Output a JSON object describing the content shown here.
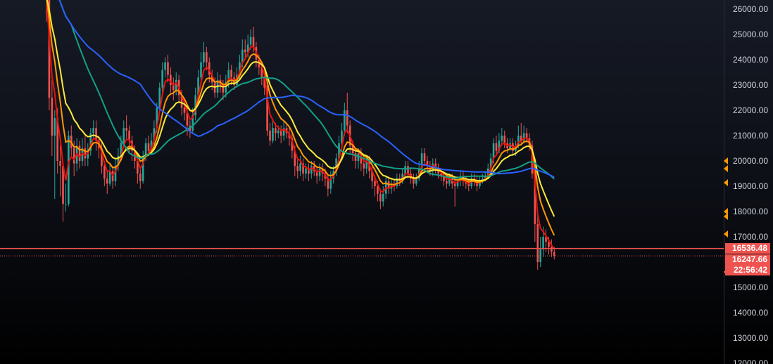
{
  "chart_data": {
    "type": "candlestick",
    "title": "",
    "xlabel": "",
    "ylabel": "",
    "ylim": [
      12000,
      26400
    ],
    "y_ticks": [
      "26000.00",
      "25000.00",
      "24000.00",
      "23000.00",
      "22000.00",
      "21000.00",
      "20000.00",
      "19000.00",
      "18000.00",
      "17000.00",
      "15000.00",
      "14000.00",
      "13000.00",
      "12000.00"
    ],
    "grid": false,
    "legend": "none",
    "colors": {
      "up": "#26a69a",
      "down": "#ef5350",
      "ma1": "#e8120c",
      "ma2": "#ff9800",
      "ma3": "#ffeb3b",
      "ma4": "#14a085",
      "ma5": "#2962ff",
      "price_line": "#ef5350"
    },
    "price_tags": [
      {
        "label": "16536.48",
        "value": 16536.48
      },
      {
        "label": "16247.66",
        "value": 16247.66
      },
      {
        "label": "22:56:42"
      }
    ],
    "candles": [
      [
        28000,
        26500,
        29000,
        25500
      ],
      [
        26500,
        22500,
        27000,
        22000
      ],
      [
        22500,
        21000,
        23200,
        20200
      ],
      [
        21000,
        21700,
        22000,
        18500
      ],
      [
        21700,
        20000,
        22100,
        19500
      ],
      [
        20000,
        19800,
        20600,
        18600
      ],
      [
        19800,
        18300,
        20000,
        17600
      ],
      [
        18300,
        18300,
        19100,
        18000
      ],
      [
        18300,
        21000,
        21200,
        18200
      ],
      [
        21000,
        20500,
        21400,
        20200
      ],
      [
        20500,
        19900,
        20800,
        19400
      ],
      [
        19900,
        20600,
        20900,
        19600
      ],
      [
        20600,
        20000,
        20800,
        19700
      ],
      [
        20000,
        20500,
        20900,
        19800
      ],
      [
        20500,
        20100,
        21000,
        19800
      ],
      [
        20100,
        20400,
        20700,
        19800
      ],
      [
        20400,
        21100,
        21300,
        20200
      ],
      [
        21100,
        21300,
        21600,
        20900
      ],
      [
        21300,
        20800,
        21600,
        20400
      ],
      [
        20800,
        20500,
        21000,
        20100
      ],
      [
        20500,
        19800,
        20700,
        19500
      ],
      [
        19800,
        19300,
        20000,
        19000
      ],
      [
        19300,
        19100,
        19600,
        18700
      ],
      [
        19100,
        19600,
        19900,
        19000
      ],
      [
        19600,
        19200,
        19800,
        18900
      ],
      [
        19200,
        19800,
        20100,
        19000
      ],
      [
        19800,
        20200,
        20500,
        19600
      ],
      [
        20200,
        20700,
        21000,
        20000
      ],
      [
        20700,
        21300,
        21600,
        20500
      ],
      [
        21300,
        21200,
        21800,
        20900
      ],
      [
        21200,
        20800,
        21400,
        20300
      ],
      [
        20800,
        20400,
        21000,
        20000
      ],
      [
        20400,
        20000,
        20600,
        19700
      ],
      [
        20000,
        19500,
        20200,
        19100
      ],
      [
        19500,
        19200,
        19700,
        18900
      ],
      [
        19200,
        20200,
        20400,
        19100
      ],
      [
        20200,
        20700,
        20900,
        20000
      ],
      [
        20700,
        20400,
        21000,
        20200
      ],
      [
        20400,
        20800,
        21100,
        20300
      ],
      [
        20800,
        21300,
        21600,
        20600
      ],
      [
        21300,
        22100,
        22300,
        21100
      ],
      [
        22100,
        22900,
        23100,
        21900
      ],
      [
        22900,
        23600,
        23900,
        22700
      ],
      [
        23600,
        23900,
        24100,
        23300
      ],
      [
        23900,
        23400,
        24200,
        23100
      ],
      [
        23400,
        23000,
        23700,
        22700
      ],
      [
        23000,
        22800,
        23300,
        22400
      ],
      [
        22800,
        23200,
        23500,
        22600
      ],
      [
        23200,
        22600,
        23400,
        22300
      ],
      [
        22600,
        22100,
        22800,
        21800
      ],
      [
        22100,
        21900,
        22400,
        21600
      ],
      [
        21900,
        21400,
        22100,
        21000
      ],
      [
        21400,
        21200,
        21600,
        20900
      ],
      [
        21200,
        21800,
        22100,
        21100
      ],
      [
        21800,
        22600,
        22900,
        21600
      ],
      [
        22600,
        23300,
        23600,
        22400
      ],
      [
        23300,
        23900,
        24300,
        23100
      ],
      [
        23900,
        24300,
        24700,
        23700
      ],
      [
        24300,
        23900,
        24500,
        23600
      ],
      [
        23900,
        23400,
        24100,
        23100
      ],
      [
        23400,
        23100,
        23600,
        22800
      ],
      [
        23100,
        22700,
        23300,
        22500
      ],
      [
        22700,
        23200,
        23500,
        22500
      ],
      [
        23200,
        23000,
        23400,
        22700
      ],
      [
        23000,
        22700,
        23200,
        22400
      ],
      [
        22700,
        23100,
        23400,
        22500
      ],
      [
        23100,
        23600,
        23900,
        22900
      ],
      [
        23600,
        23300,
        23800,
        23000
      ],
      [
        23300,
        23000,
        23500,
        22800
      ],
      [
        23000,
        23400,
        23700,
        22900
      ],
      [
        23400,
        23900,
        24200,
        23200
      ],
      [
        23900,
        24400,
        24800,
        23700
      ],
      [
        24400,
        24300,
        24800,
        24000
      ],
      [
        24300,
        24600,
        25000,
        24100
      ],
      [
        24600,
        24900,
        25200,
        24400
      ],
      [
        24900,
        24500,
        25300,
        24300
      ],
      [
        24500,
        24000,
        24700,
        23700
      ],
      [
        24000,
        23700,
        24200,
        23400
      ],
      [
        23700,
        23300,
        23900,
        23000
      ],
      [
        23300,
        22900,
        23500,
        22600
      ],
      [
        22900,
        21200,
        23000,
        21000
      ],
      [
        21200,
        20800,
        21500,
        20600
      ],
      [
        20800,
        21300,
        21600,
        20700
      ],
      [
        21300,
        21100,
        21500,
        20800
      ],
      [
        21100,
        21200,
        21400,
        20900
      ],
      [
        21200,
        21000,
        21400,
        20700
      ],
      [
        21000,
        21300,
        21600,
        20800
      ],
      [
        21300,
        21100,
        21500,
        20900
      ],
      [
        21100,
        20900,
        21300,
        20600
      ],
      [
        20900,
        20400,
        21100,
        20100
      ],
      [
        20400,
        19800,
        20600,
        19400
      ],
      [
        19800,
        19600,
        20100,
        19300
      ],
      [
        19600,
        19900,
        20200,
        19400
      ],
      [
        19900,
        19500,
        20100,
        19200
      ],
      [
        19500,
        19700,
        19900,
        19300
      ],
      [
        19700,
        19500,
        19900,
        19200
      ],
      [
        19500,
        19800,
        20000,
        19300
      ],
      [
        19800,
        19600,
        20000,
        19400
      ],
      [
        19600,
        19400,
        19800,
        19100
      ],
      [
        19400,
        19700,
        19900,
        19200
      ],
      [
        19700,
        19500,
        19900,
        19200
      ],
      [
        19500,
        19300,
        19700,
        19000
      ],
      [
        19300,
        18900,
        19500,
        18600
      ],
      [
        18900,
        19300,
        19600,
        18700
      ],
      [
        19300,
        19600,
        19800,
        19100
      ],
      [
        19600,
        20100,
        20300,
        19400
      ],
      [
        20100,
        20700,
        21000,
        19900
      ],
      [
        20700,
        21200,
        21500,
        20500
      ],
      [
        21200,
        22000,
        22300,
        21000
      ],
      [
        22000,
        21400,
        22700,
        21100
      ],
      [
        21400,
        20600,
        21600,
        20300
      ],
      [
        20600,
        20300,
        20800,
        20000
      ],
      [
        20300,
        20000,
        20500,
        19700
      ],
      [
        20000,
        20300,
        20500,
        19700
      ],
      [
        20300,
        19900,
        20500,
        19600
      ],
      [
        19900,
        19700,
        20100,
        19400
      ],
      [
        19700,
        20000,
        20200,
        19500
      ],
      [
        20000,
        19600,
        20200,
        19300
      ],
      [
        19600,
        19200,
        19800,
        18900
      ],
      [
        19200,
        19000,
        19400,
        18600
      ],
      [
        19000,
        18700,
        19200,
        18400
      ],
      [
        18700,
        18400,
        18900,
        18100
      ],
      [
        18400,
        18700,
        19000,
        18200
      ],
      [
        18700,
        19200,
        19400,
        18500
      ],
      [
        19200,
        18900,
        19400,
        18700
      ],
      [
        18900,
        19100,
        19300,
        18700
      ],
      [
        19100,
        19000,
        19300,
        18800
      ],
      [
        19000,
        19300,
        19500,
        18900
      ],
      [
        19300,
        19200,
        19500,
        19000
      ],
      [
        19200,
        19500,
        19700,
        19100
      ],
      [
        19500,
        19800,
        20000,
        19300
      ],
      [
        19800,
        19500,
        20000,
        19300
      ],
      [
        19500,
        19300,
        19700,
        19100
      ],
      [
        19300,
        19100,
        19500,
        18900
      ],
      [
        19100,
        19300,
        19500,
        19000
      ],
      [
        19300,
        19700,
        20000,
        19200
      ],
      [
        19700,
        20300,
        20500,
        19600
      ],
      [
        20300,
        20000,
        20500,
        19800
      ],
      [
        20000,
        19800,
        20200,
        19600
      ],
      [
        19800,
        19600,
        20000,
        19400
      ],
      [
        19600,
        19900,
        20100,
        19400
      ],
      [
        19900,
        19700,
        20100,
        19500
      ],
      [
        19700,
        19500,
        19900,
        19300
      ],
      [
        19500,
        19400,
        19700,
        19200
      ],
      [
        19400,
        19200,
        19600,
        19000
      ],
      [
        19200,
        19100,
        19400,
        18900
      ],
      [
        19100,
        19300,
        19500,
        19000
      ],
      [
        19300,
        19100,
        19500,
        18900
      ],
      [
        19100,
        19000,
        19300,
        18200
      ],
      [
        19000,
        19200,
        19400,
        18900
      ],
      [
        19200,
        19400,
        19600,
        19000
      ],
      [
        19400,
        19200,
        19600,
        19000
      ],
      [
        19200,
        19100,
        19400,
        18900
      ],
      [
        19100,
        19000,
        19300,
        18800
      ],
      [
        19000,
        19300,
        19500,
        18900
      ],
      [
        19300,
        19200,
        19500,
        19000
      ],
      [
        19200,
        19000,
        19400,
        18800
      ],
      [
        19000,
        19200,
        19400,
        18900
      ],
      [
        19200,
        19300,
        19500,
        19100
      ],
      [
        19300,
        19400,
        19600,
        19200
      ],
      [
        19400,
        19700,
        19900,
        19300
      ],
      [
        19700,
        20100,
        20300,
        19500
      ],
      [
        20100,
        20700,
        20900,
        19900
      ],
      [
        20700,
        20400,
        21000,
        20200
      ],
      [
        20400,
        20800,
        21100,
        20300
      ],
      [
        20800,
        21000,
        21300,
        20600
      ],
      [
        21000,
        20700,
        21200,
        20500
      ],
      [
        20700,
        20500,
        20900,
        20300
      ],
      [
        20500,
        20700,
        20900,
        20400
      ],
      [
        20700,
        20400,
        20900,
        20200
      ],
      [
        20400,
        20600,
        20800,
        20200
      ],
      [
        20600,
        21000,
        21400,
        20500
      ],
      [
        21000,
        20800,
        21500,
        20600
      ],
      [
        20800,
        21100,
        21400,
        20700
      ],
      [
        21100,
        20900,
        21300,
        20700
      ],
      [
        20900,
        20600,
        21100,
        20400
      ],
      [
        20600,
        19500,
        20800,
        19300
      ],
      [
        19500,
        17500,
        19700,
        16800
      ],
      [
        17500,
        16000,
        18000,
        15700
      ],
      [
        16000,
        16500,
        17000,
        15800
      ],
      [
        16500,
        17000,
        17400,
        16200
      ],
      [
        17000,
        16800,
        17300,
        16400
      ],
      [
        16800,
        16600,
        17000,
        16300
      ],
      [
        16600,
        16400,
        16900,
        16200
      ],
      [
        16400,
        16250,
        16600,
        16100
      ]
    ]
  }
}
